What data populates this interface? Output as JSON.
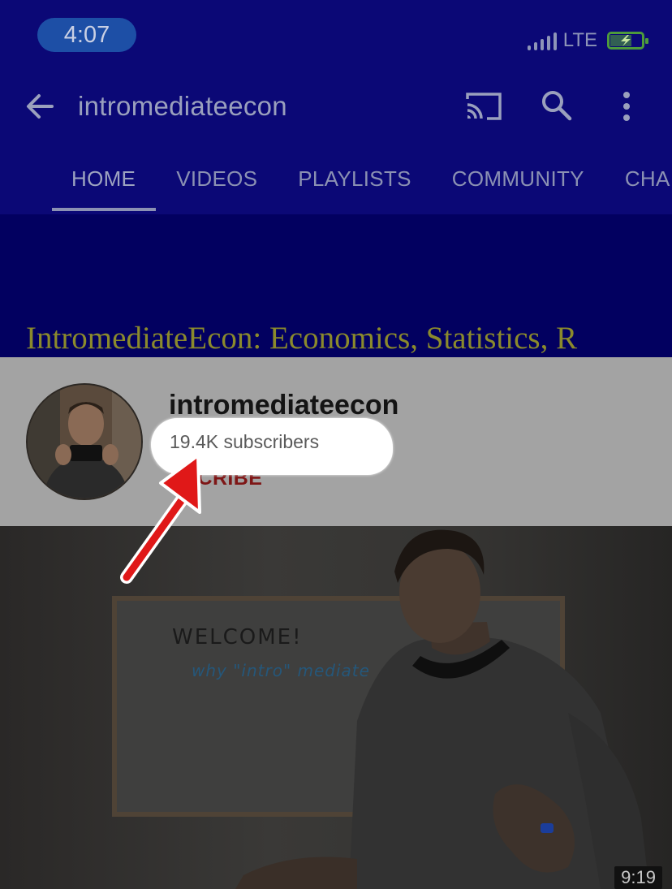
{
  "status_bar": {
    "time": "4:07",
    "network": "LTE",
    "battery_icon": "battery-charging-icon"
  },
  "app_bar": {
    "title": "intromediateecon",
    "icons": [
      "back-arrow-icon",
      "cast-icon",
      "search-icon",
      "more-vert-icon"
    ]
  },
  "tabs": [
    {
      "label": "HOME",
      "active": true
    },
    {
      "label": "VIDEOS",
      "active": false
    },
    {
      "label": "PLAYLISTS",
      "active": false
    },
    {
      "label": "COMMUNITY",
      "active": false
    },
    {
      "label": "CHA",
      "active": false
    }
  ],
  "banner": {
    "text": "IntromediateEcon: Economics, Statistics, R"
  },
  "channel": {
    "name": "intromediateecon",
    "subscribers": "19.4K subscribers",
    "subscribe_visible": "BSCRIBE"
  },
  "video": {
    "whiteboard_line1": "WELCOME!",
    "whiteboard_line2": "why \"intro\" mediate",
    "duration": "9:19"
  },
  "colors": {
    "header_bg": "#0b0876",
    "banner_bg": "#020060",
    "card_bg": "#a3a3a3",
    "subscribe_red": "#7e1616",
    "annotation_red": "#e01818"
  }
}
